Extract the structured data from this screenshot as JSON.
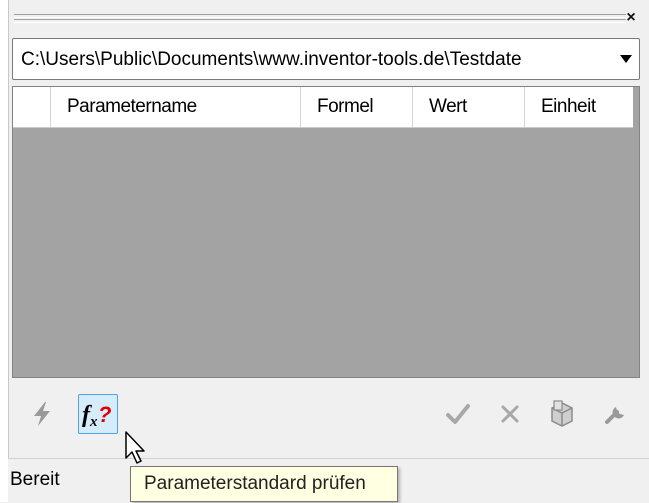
{
  "window": {
    "close_symbol": "×"
  },
  "path_selector": {
    "value": "C:\\Users\\Public\\Documents\\www.inventor-tools.de\\Testdate"
  },
  "grid": {
    "columns": [
      "",
      "Parametername",
      "Formel",
      "Wert",
      "Einheit"
    ],
    "rows": []
  },
  "toolbar": {
    "buttons": [
      {
        "icon": "lightning-icon",
        "enabled": false
      },
      {
        "icon": "function-check-icon",
        "label": "fx?",
        "enabled": true,
        "active": true
      },
      {
        "icon": "checkmark-icon",
        "enabled": false
      },
      {
        "icon": "close-icon",
        "enabled": false
      },
      {
        "icon": "part-icon",
        "enabled": false
      },
      {
        "icon": "wrench-icon",
        "enabled": false
      }
    ]
  },
  "status": {
    "text": "Bereit"
  },
  "tooltip": {
    "text": "Parameterstandard prüfen"
  },
  "colors": {
    "grid_background": "#a3a3a3",
    "active_button_bg": "#d6ecfb",
    "active_button_border": "#4fa3e6",
    "fx_question_mark": "#e00000",
    "tooltip_bg": "#ffffe1"
  }
}
